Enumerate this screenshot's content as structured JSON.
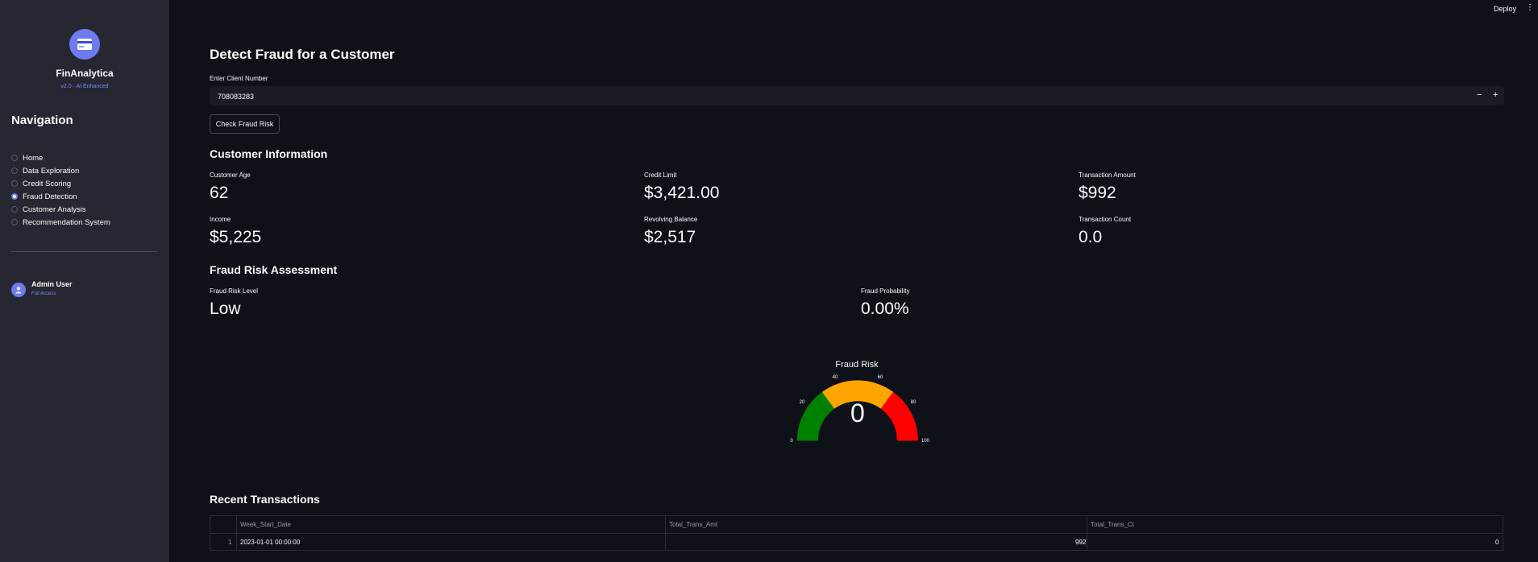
{
  "app": {
    "brand_name": "FinAnalytica",
    "brand_version": "v2.0 · AI Enhanced",
    "deploy_label": "Deploy",
    "menu_icon": "⋮"
  },
  "sidebar": {
    "nav_title": "Navigation",
    "items": [
      {
        "label": "Home",
        "selected": false
      },
      {
        "label": "Data Exploration",
        "selected": false
      },
      {
        "label": "Credit Scoring",
        "selected": false
      },
      {
        "label": "Fraud Detection",
        "selected": true
      },
      {
        "label": "Customer Analysis",
        "selected": false
      },
      {
        "label": "Recommendation System",
        "selected": false
      }
    ],
    "user_name": "Admin User",
    "user_role": "Full Access"
  },
  "main": {
    "title": "Detect Fraud for a Customer",
    "client_label": "Enter Client Number",
    "client_value": "708083283",
    "stepper_minus": "−",
    "stepper_plus": "+",
    "check_button": "Check Fraud Risk",
    "customer_info_title": "Customer Information",
    "metrics": [
      {
        "label": "Customer Age",
        "value": "62"
      },
      {
        "label": "Credit Limit",
        "value": "$3,421.00"
      },
      {
        "label": "Transaction Amount",
        "value": "$992"
      },
      {
        "label": "Income",
        "value": "$5,225"
      },
      {
        "label": "Revolving Balance",
        "value": "$2,517"
      },
      {
        "label": "Transaction Count",
        "value": "0.0"
      }
    ],
    "risk_title": "Fraud Risk Assessment",
    "risk_level_label": "Fraud Risk Level",
    "risk_level_value": "Low",
    "probability_label": "Fraud Probability",
    "probability_value": "0.00%",
    "gauge": {
      "title": "Fraud Risk",
      "value": "0",
      "ticks": [
        "0",
        "20",
        "40",
        "60",
        "80",
        "100"
      ],
      "colors": {
        "low": "#008000",
        "mid": "#ffa500",
        "high": "#ff0000"
      }
    },
    "recent_title": "Recent Transactions",
    "table": {
      "columns": [
        "Week_Start_Date",
        "Total_Trans_Amt",
        "Total_Trans_Ct"
      ],
      "rows": [
        {
          "index": "1",
          "cells": [
            "2023-01-01 00:00:00",
            "992",
            "0"
          ]
        }
      ]
    }
  },
  "theme": {
    "background": "#0e1117",
    "sidebar": "#262730",
    "accent": "#6c7bf0"
  }
}
